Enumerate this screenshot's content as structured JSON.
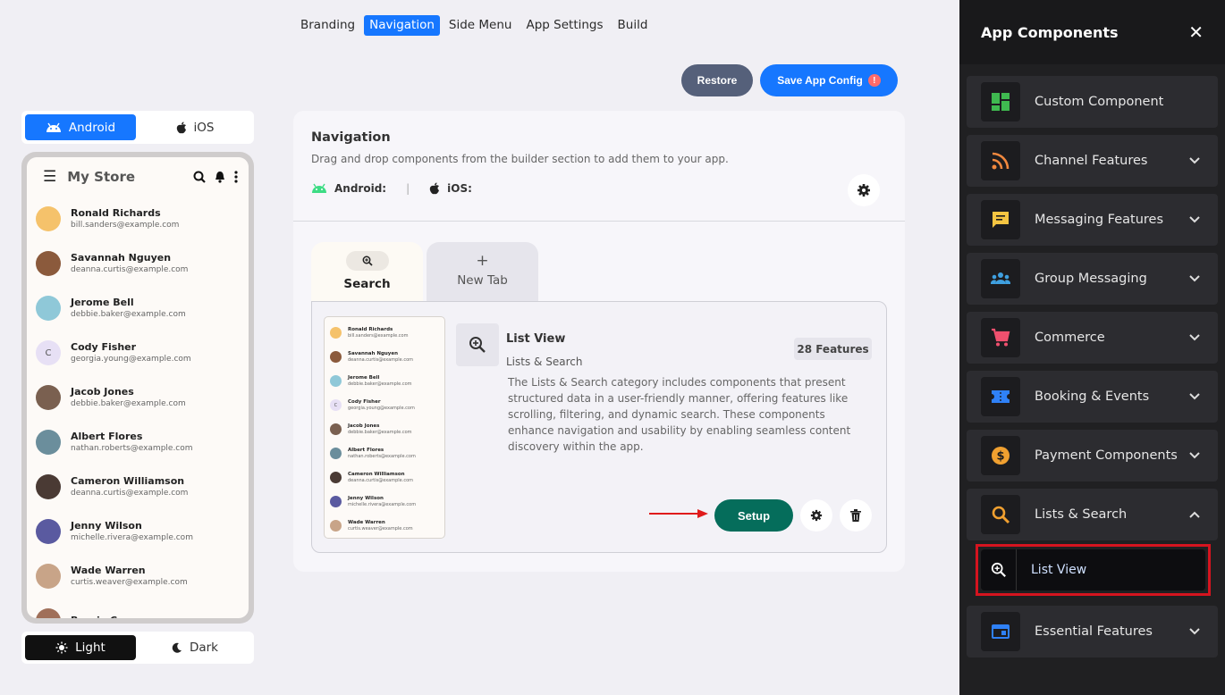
{
  "top_tabs": [
    "Branding",
    "Navigation",
    "Side Menu",
    "App Settings",
    "Build"
  ],
  "actions": {
    "restore": "Restore",
    "save": "Save App Config",
    "save_badge": "!"
  },
  "platform": {
    "android": "Android",
    "ios": "iOS"
  },
  "theme": {
    "light": "Light",
    "dark": "Dark"
  },
  "phone": {
    "title": "My Store",
    "contacts": [
      {
        "name": "Ronald Richards",
        "email": "bill.sanders@example.com",
        "color": "#f5c26b",
        "initial": ""
      },
      {
        "name": "Savannah Nguyen",
        "email": "deanna.curtis@example.com",
        "color": "#8b5a3c",
        "initial": ""
      },
      {
        "name": "Jerome Bell",
        "email": "debbie.baker@example.com",
        "color": "#8fc8d8",
        "initial": ""
      },
      {
        "name": "Cody Fisher",
        "email": "georgia.young@example.com",
        "color": "#e7e0f5",
        "initial": "C"
      },
      {
        "name": "Jacob Jones",
        "email": "debbie.baker@example.com",
        "color": "#7a6050",
        "initial": ""
      },
      {
        "name": "Albert Flores",
        "email": "nathan.roberts@example.com",
        "color": "#6b8e9c",
        "initial": ""
      },
      {
        "name": "Cameron Williamson",
        "email": "deanna.curtis@example.com",
        "color": "#4a3a34",
        "initial": ""
      },
      {
        "name": "Jenny Wilson",
        "email": "michelle.rivera@example.com",
        "color": "#5a5aa0",
        "initial": ""
      },
      {
        "name": "Wade Warren",
        "email": "curtis.weaver@example.com",
        "color": "#c8a488",
        "initial": ""
      },
      {
        "name": "Bessie Cooper",
        "email": "",
        "color": "#a0705a",
        "initial": ""
      }
    ]
  },
  "nav": {
    "title": "Navigation",
    "subtitle": "Drag and drop components from the builder section to add them to your app.",
    "android_label": "Android:",
    "ios_label": "iOS:",
    "tabs": {
      "search": "Search",
      "new_tab": "New Tab",
      "plus": "+"
    },
    "listview": {
      "title": "List View",
      "category": "Lists & Search",
      "badge": "28 Features",
      "description": "The Lists & Search category includes components that present structured data in a user-friendly manner, offering features like scrolling, filtering, and dynamic search. These components enhance navigation and usability by enabling seamless content discovery within the app.",
      "setup": "Setup"
    }
  },
  "panel": {
    "title": "App Components",
    "close": "✕",
    "items": [
      {
        "label": "Custom Component",
        "icon": "grid-icon",
        "color": "#3fb950",
        "expandable": false
      },
      {
        "label": "Channel Features",
        "icon": "rss-icon",
        "color": "#f0883e",
        "expandable": true
      },
      {
        "label": "Messaging Features",
        "icon": "chat-icon",
        "color": "#f5c542",
        "expandable": true
      },
      {
        "label": "Group Messaging",
        "icon": "group-icon",
        "color": "#3fa0e0",
        "expandable": true
      },
      {
        "label": "Commerce",
        "icon": "cart-icon",
        "color": "#f0506e",
        "expandable": true
      },
      {
        "label": "Booking & Events",
        "icon": "ticket-icon",
        "color": "#2f81f7",
        "expandable": true
      },
      {
        "label": "Payment Components",
        "icon": "dollar-icon",
        "color": "#f0a030",
        "expandable": true
      },
      {
        "label": "Lists & Search",
        "icon": "search-icon",
        "color": "#f0a030",
        "expandable": true,
        "expanded": true
      },
      {
        "label": "Essential Features",
        "icon": "window-icon",
        "color": "#2f81f7",
        "expandable": true
      }
    ],
    "sub_item": {
      "label": "List View"
    }
  }
}
